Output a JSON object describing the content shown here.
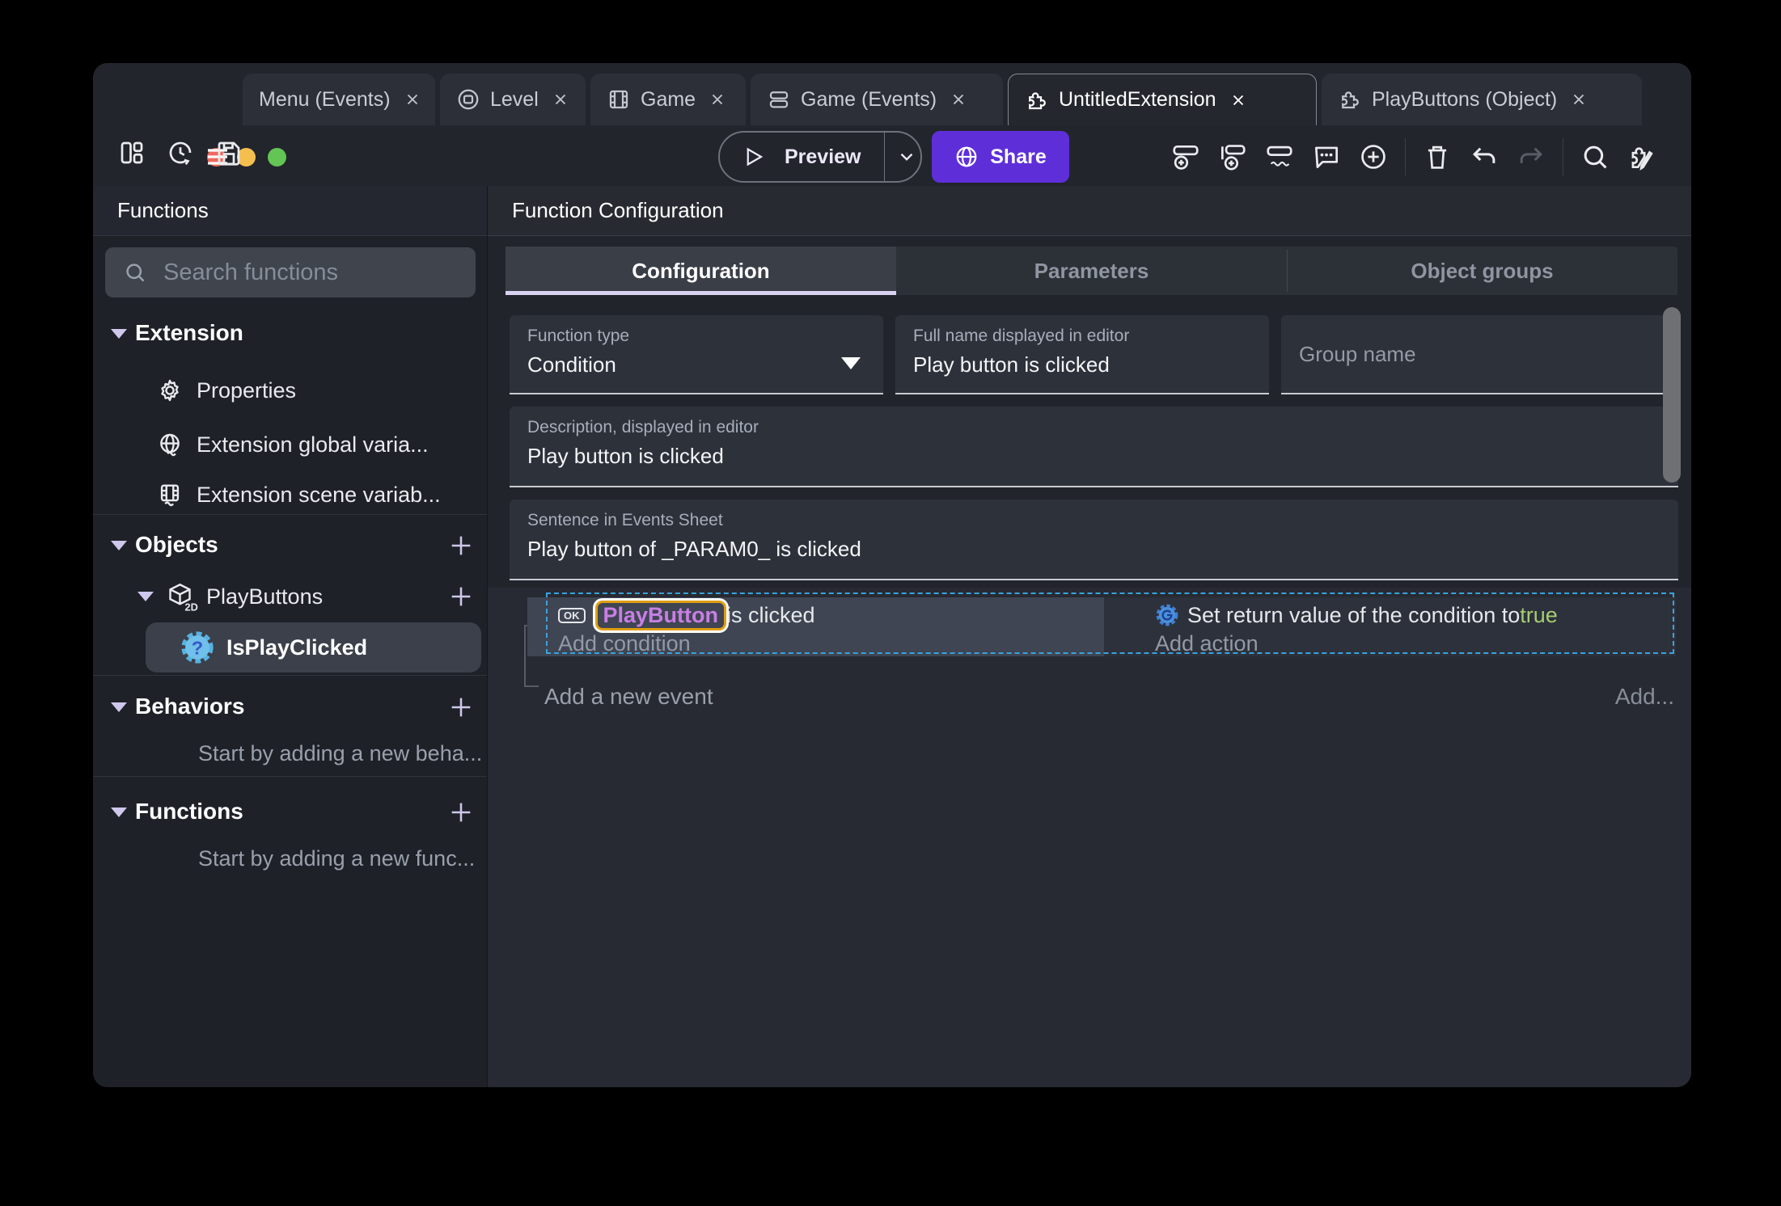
{
  "colors": {
    "accent_purple": "#5e2fd9",
    "selection_blue": "#3aa2dc",
    "object_name_violet": "#c87ee5",
    "highlight_box_orange": "#df9e12",
    "boolean_true_green": "#a6cc72",
    "traffic_red": "#ed6a5e",
    "traffic_yellow": "#f5bf4f",
    "traffic_green": "#62c554"
  },
  "titlebar": {
    "tabs": [
      {
        "label": "Menu (Events)"
      },
      {
        "label": "Level"
      },
      {
        "label": "Game"
      },
      {
        "label": "Game (Events)"
      },
      {
        "label": "UntitledExtension"
      },
      {
        "label": "PlayButtons (Object)"
      }
    ]
  },
  "toolbar": {
    "preview_label": "Preview",
    "share_label": "Share"
  },
  "sidebar": {
    "title": "Functions",
    "search_placeholder": "Search functions",
    "sections": {
      "extension": {
        "label": "Extension",
        "items": [
          {
            "label": "Properties"
          },
          {
            "label": "Extension global varia..."
          },
          {
            "label": "Extension scene variab..."
          }
        ]
      },
      "objects": {
        "label": "Objects",
        "group": "PlayButtons",
        "object_badge": "2D",
        "function": "IsPlayClicked",
        "function_icon_glyph": "?"
      },
      "behaviors": {
        "label": "Behaviors",
        "empty": "Start by adding a new beha..."
      },
      "functions": {
        "label": "Functions",
        "empty": "Start by adding a new func..."
      }
    }
  },
  "main": {
    "title": "Function Configuration",
    "tabs": [
      {
        "label": "Configuration"
      },
      {
        "label": "Parameters"
      },
      {
        "label": "Object groups"
      }
    ],
    "fields": {
      "function_type": {
        "label": "Function type",
        "value": "Condition"
      },
      "full_name": {
        "label": "Full name displayed in editor",
        "value": "Play button is clicked"
      },
      "group_name": {
        "placeholder": "Group name"
      },
      "description": {
        "label": "Description, displayed in editor",
        "value": "Play button is clicked"
      },
      "sentence": {
        "label": "Sentence in Events Sheet",
        "value": "Play button of _PARAM0_ is clicked"
      }
    },
    "events": {
      "condition_icon_label": "OK",
      "condition_object": "PlayButton",
      "condition_suffix": " is clicked",
      "add_condition": "Add condition",
      "action_prefix": "Set return value of the condition to ",
      "action_value": "true",
      "add_action": "Add action",
      "add_new_event": "Add a new event",
      "add_more": "Add..."
    }
  }
}
